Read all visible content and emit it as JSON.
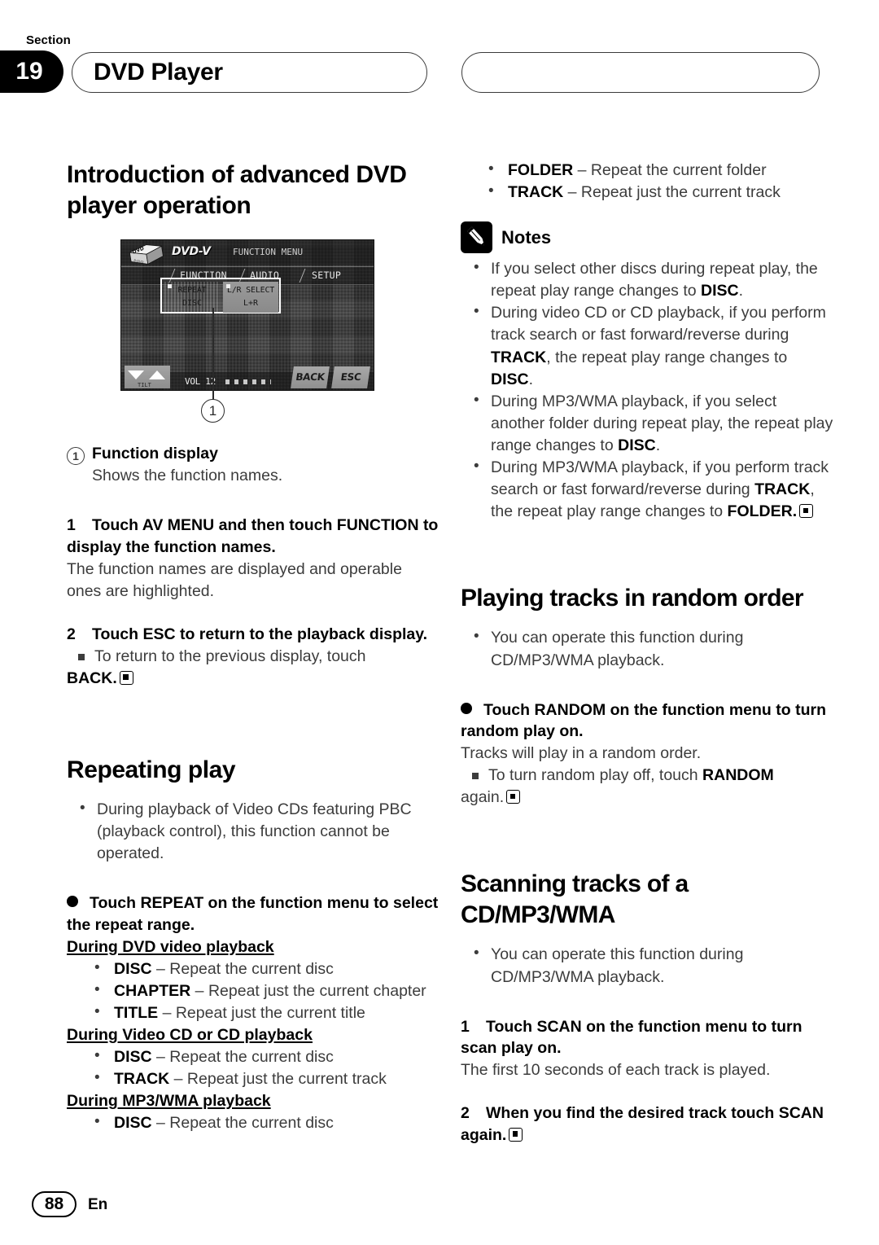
{
  "header": {
    "section_word": "Section",
    "section_number": "19",
    "title": "DVD Player"
  },
  "footer": {
    "page_number": "88",
    "language": "En"
  },
  "figure": {
    "dvd_logo_text": "DVD",
    "dvd_logo_sub": "8-DVD",
    "disc_type": "DVD-V",
    "menu_title": "FUNCTION MENU",
    "tabs": [
      "FUNCTION",
      "AUDIO",
      "SETUP"
    ],
    "cells": [
      {
        "label": "REPEAT",
        "value": "DISC"
      },
      {
        "label": "L/R SELECT",
        "value": "L+R"
      }
    ],
    "tilt_label": "TILT",
    "volume": "VOL 12",
    "back_button": "BACK",
    "esc_button": "ESC",
    "callout": "1"
  },
  "left": {
    "heading": "Introduction of advanced DVD player operation",
    "callout_marker": "1",
    "callout_title": "Function display",
    "callout_desc": "Shows the function names.",
    "step1_num": "1",
    "step1_text": "Touch AV MENU and then touch FUNCTION to display the function names.",
    "step1_desc": "The function names are displayed and operable ones are highlighted.",
    "step2_num": "2",
    "step2_text": "Touch ESC to return to the playback display.",
    "step2_note_lead": "To return to the previous display, touch ",
    "step2_note_bold": "BACK",
    "step2_note_tail": ".",
    "repeating_heading": "Repeating play",
    "repeating_bullet": "During playback of Video CDs featuring PBC (playback control), this function cannot be operated.",
    "repeat_action": "Touch REPEAT on the function menu to select the repeat range.",
    "dvd_sub": "During DVD video playback",
    "dvd_items": [
      {
        "term": "DISC",
        "desc": " – Repeat the current disc"
      },
      {
        "term": "CHAPTER",
        "desc": " – Repeat just the current chapter"
      },
      {
        "term": "TITLE",
        "desc": " – Repeat just the current title"
      }
    ],
    "vcd_sub": "During Video CD or CD playback",
    "vcd_items": [
      {
        "term": "DISC",
        "desc": " – Repeat the current disc"
      },
      {
        "term": "TRACK",
        "desc": " – Repeat just the current track"
      }
    ],
    "mp3_sub": "During MP3/WMA playback",
    "mp3_items": [
      {
        "term": "DISC",
        "desc": " – Repeat the current disc"
      }
    ]
  },
  "right": {
    "mp3_items_cont": [
      {
        "term": "FOLDER",
        "desc": " – Repeat the current folder"
      },
      {
        "term": "TRACK",
        "desc": " – Repeat just the current track"
      }
    ],
    "notes_label": "Notes",
    "note1_a": "If you select other discs during repeat play, the repeat play range changes to ",
    "note1_b": "DISC",
    "note1_c": ".",
    "note2_a": "During video CD or CD playback, if you perform track search or fast forward/reverse during ",
    "note2_b": "TRACK",
    "note2_c": ", the repeat play range changes to ",
    "note2_d": "DISC",
    "note2_e": ".",
    "note3_a": "During MP3/WMA playback, if you select another folder during repeat play, the repeat play range changes to ",
    "note3_b": "DISC",
    "note3_c": ".",
    "note4_a": "During MP3/WMA playback, if you perform track search or fast forward/reverse during ",
    "note4_b": "TRACK",
    "note4_c": ", the repeat play range changes to ",
    "note4_d": "FOLDER",
    "note4_e": ".",
    "random_heading": "Playing tracks in random order",
    "random_bullet": "You can operate this function during CD/MP3/WMA playback.",
    "random_action": "Touch RANDOM on the function menu to turn random play on.",
    "random_desc": "Tracks will play in a random order.",
    "random_note_lead": "To turn random play off, touch ",
    "random_note_bold": "RANDOM",
    "random_note_tail": " again.",
    "scan_heading": "Scanning tracks of a CD/MP3/WMA",
    "scan_bullet": "You can operate this function during CD/MP3/WMA playback.",
    "scan_step1_num": "1",
    "scan_step1_text": "Touch SCAN on the function menu to turn scan play on.",
    "scan_step1_desc": "The first 10 seconds of each track is played.",
    "scan_step2_num": "2",
    "scan_step2_text": "When you find the desired track touch SCAN again."
  }
}
